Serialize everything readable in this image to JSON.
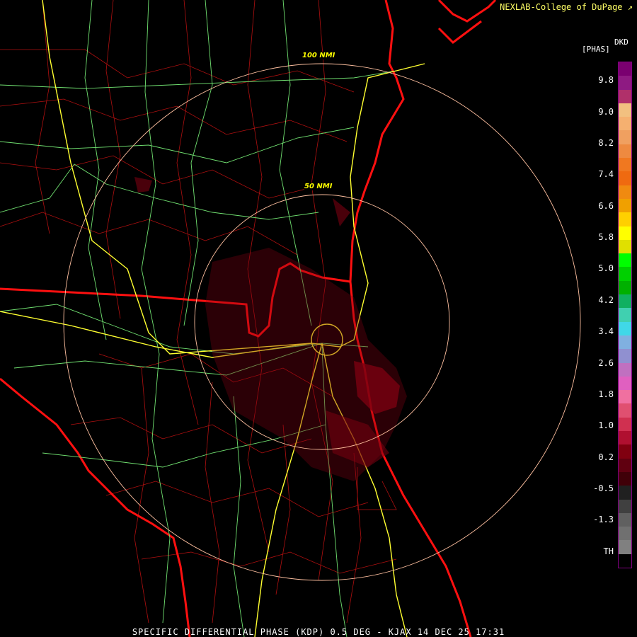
{
  "credit": "NEXLAB-College of DuPage",
  "product": {
    "code": "DKD",
    "units": "[PHAS]"
  },
  "range_rings": [
    "100 NMI",
    "50 NMI"
  ],
  "caption": "SPECIFIC DIFFERENTIAL PHASE (KDP) 0.5 DEG - KJAX 14 DEC 25 17:31",
  "legend": {
    "ticks": [
      "9.8",
      "9.0",
      "8.2",
      "7.4",
      "6.6",
      "5.8",
      "5.0",
      "4.2",
      "3.4",
      "2.6",
      "1.8",
      "1.0",
      "0.2",
      "-0.5",
      "-1.3",
      "TH"
    ],
    "colors": [
      "#7a0070",
      "#8e1a82",
      "#b0306a",
      "#f2c080",
      "#f5b070",
      "#f0a060",
      "#ee8a40",
      "#f07820",
      "#ef6a10",
      "#f08a10",
      "#f0a000",
      "#ffd000",
      "#ffff00",
      "#e0e000",
      "#00ff00",
      "#00d000",
      "#00b000",
      "#10b060",
      "#40d0b0",
      "#40d8e8",
      "#80b0e0",
      "#9090d0",
      "#c070c0",
      "#e060c0",
      "#f070a0",
      "#e05070",
      "#d03050",
      "#b01030",
      "#800010",
      "#600010",
      "#400008",
      "#202020",
      "#404040",
      "#606060",
      "#707070",
      "#808080",
      "#000000"
    ]
  },
  "colors": {
    "background": "#000000",
    "county_lines": "#c01010",
    "state_lines": "#ff0000",
    "highways": "#80ff80",
    "interstates": "#ffff40",
    "range_rings": "#ffc0a0",
    "echoes": "#800010"
  }
}
